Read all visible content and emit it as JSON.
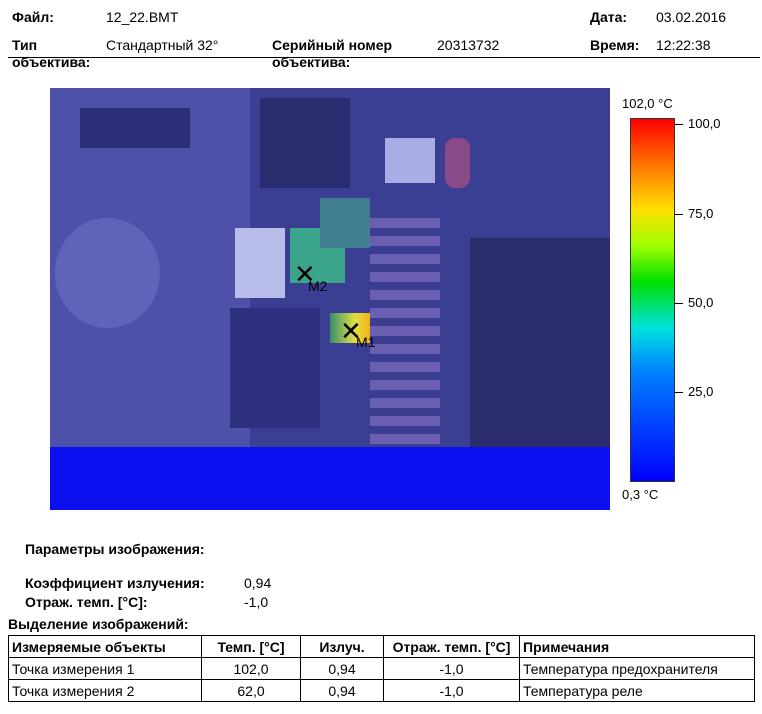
{
  "header": {
    "file_label": "Файл:",
    "file_value": "12_22.BMT",
    "date_label": "Дата:",
    "date_value": "03.02.2016",
    "lens_label_1": "Тип",
    "lens_label_2": "объектива:",
    "lens_value": "Стандартный 32°",
    "serial_label_1": "Серийный номер",
    "serial_label_2": "объектива:",
    "serial_value": "20313732",
    "time_label": "Время:",
    "time_value": "12:22:38"
  },
  "thermogram": {
    "markers": [
      {
        "label": "M1"
      },
      {
        "label": "M2"
      }
    ],
    "scale": {
      "max_label": "102,0 °C",
      "min_label": "0,3 °C",
      "ticks": [
        "100,0",
        "75,0",
        "50,0",
        "25,0"
      ]
    }
  },
  "params": {
    "title": "Параметры изображения:",
    "emissivity_label": "Коэффициент излучения:",
    "emissivity_value": "0,94",
    "refl_label": "Отраж. темп. [°C]:",
    "refl_value": "-1,0"
  },
  "selection": {
    "title": "Выделение изображений:",
    "headers": [
      "Измеряемые объекты",
      "Темп. [°C]",
      "Излуч.",
      "Отраж. темп. [°C]",
      "Примечания"
    ],
    "rows": [
      [
        "Точка измерения 1",
        "102,0",
        "0,94",
        "-1,0",
        "Температура предохранителя"
      ],
      [
        "Точка измерения 2",
        "62,0",
        "0,94",
        "-1,0",
        "Температура реле"
      ]
    ]
  }
}
